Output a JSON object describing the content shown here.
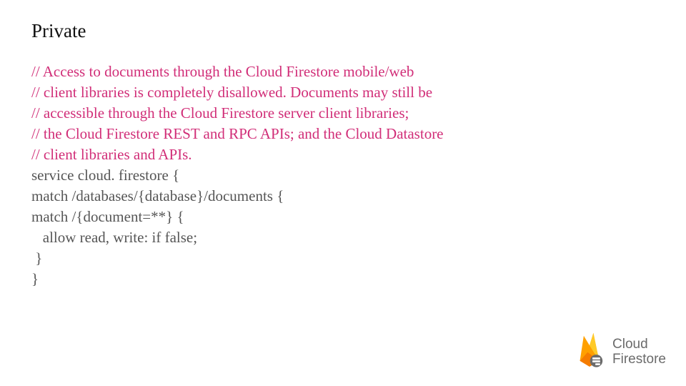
{
  "title": "Private",
  "code": {
    "comment_lines": [
      "// Access to documents through the Cloud Firestore mobile/web",
      "// client libraries is completely disallowed. Documents may still be",
      "// accessible through the Cloud Firestore server client libraries;",
      "// the Cloud Firestore REST and RPC APIs; and the Cloud Datastore",
      "// client libraries and APIs."
    ],
    "body_lines": [
      "service cloud. firestore {",
      "match /databases/{database}/documents {",
      "match /{document=**} {",
      "   allow read, write: if false;",
      " }",
      "}"
    ]
  },
  "logo": {
    "line1": "Cloud",
    "line2": "Firestore"
  }
}
